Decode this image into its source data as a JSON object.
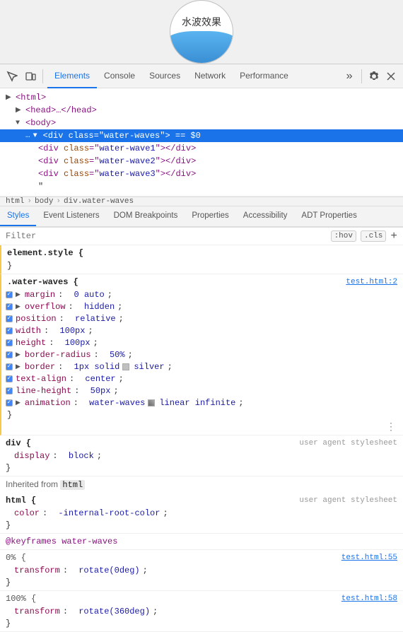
{
  "preview": {
    "label": "水波效果"
  },
  "tabs": {
    "main": [
      {
        "id": "elements",
        "label": "Elements",
        "active": true
      },
      {
        "id": "console",
        "label": "Console"
      },
      {
        "id": "sources",
        "label": "Sources"
      },
      {
        "id": "network",
        "label": "Network"
      },
      {
        "id": "performance",
        "label": "Performance"
      }
    ],
    "sub": [
      {
        "id": "styles",
        "label": "Styles",
        "active": true
      },
      {
        "id": "event-listeners",
        "label": "Event Listeners"
      },
      {
        "id": "dom-breakpoints",
        "label": "DOM Breakpoints"
      },
      {
        "id": "properties",
        "label": "Properties"
      },
      {
        "id": "accessibility",
        "label": "Accessibility"
      },
      {
        "id": "adt-properties",
        "label": "ADT Properties"
      }
    ]
  },
  "dom": {
    "lines": [
      {
        "id": "html",
        "indent": 0,
        "content": "<html>",
        "triangle": "▶",
        "selected": false
      },
      {
        "id": "head",
        "indent": 1,
        "content": "<head>…</head>",
        "triangle": "▶",
        "selected": false
      },
      {
        "id": "body",
        "indent": 1,
        "content": "<body>",
        "triangle": "▼",
        "selected": false
      },
      {
        "id": "div-water-waves",
        "indent": 2,
        "content": "<div class=\"water-waves\"> == $0",
        "triangle": "▼",
        "selected": true
      },
      {
        "id": "div-wave1",
        "indent": 3,
        "content": "<div class=\"water-wave1\"></div>",
        "triangle": "",
        "selected": false
      },
      {
        "id": "div-wave2",
        "indent": 3,
        "content": "<div class=\"water-wave2\"></div>",
        "triangle": "",
        "selected": false
      },
      {
        "id": "div-wave3",
        "indent": 3,
        "content": "<div class=\"water-wave3\"></div>",
        "triangle": "",
        "selected": false
      },
      {
        "id": "quote",
        "indent": 3,
        "content": "\"",
        "triangle": "",
        "selected": false
      }
    ]
  },
  "breadcrumb": {
    "items": [
      "html",
      "body",
      "div.water-waves"
    ]
  },
  "filter": {
    "placeholder": "Filter",
    "hov_label": ":hov",
    "cls_label": ".cls"
  },
  "styles": {
    "sections": [
      {
        "id": "element-style",
        "selector": "element.style {",
        "source": "",
        "props": [],
        "close": "}"
      },
      {
        "id": "water-waves",
        "selector": ".water-waves {",
        "source": "test.html:2",
        "props": [
          {
            "name": "margin",
            "colon": ":",
            "val": "▶ 0 auto",
            "semi": ";",
            "checked": true,
            "triangle": true
          },
          {
            "name": "overflow",
            "colon": ":",
            "val": "▶ hidden",
            "semi": ";",
            "checked": true,
            "triangle": true
          },
          {
            "name": "position",
            "colon": ":",
            "val": "relative",
            "semi": ";",
            "checked": true,
            "triangle": false
          },
          {
            "name": "width",
            "colon": ":",
            "val": "100px",
            "semi": ";",
            "checked": true,
            "triangle": false
          },
          {
            "name": "height",
            "colon": ":",
            "val": "100px",
            "semi": ";",
            "checked": true,
            "triangle": false
          },
          {
            "name": "border-radius",
            "colon": ":",
            "val": "▶ 50%",
            "semi": ";",
            "checked": true,
            "triangle": true
          },
          {
            "name": "border",
            "colon": ":",
            "val": "▶ 1px solid",
            "semi": "",
            "color": "silver",
            "colorname": "silver",
            "checked": true,
            "triangle": true
          },
          {
            "name": "text-align",
            "colon": ":",
            "val": "center",
            "semi": ";",
            "checked": true,
            "triangle": false
          },
          {
            "name": "line-height",
            "colon": ":",
            "val": "50px",
            "semi": ";",
            "checked": true,
            "triangle": false
          },
          {
            "name": "animation",
            "colon": ":",
            "val": "▶ water-waves",
            "semi": "",
            "checked": true,
            "triangle": true,
            "extra": "linear infinite",
            "checkbox2": true
          }
        ],
        "close": "}"
      },
      {
        "id": "div-user-agent",
        "selector": "div {",
        "source": "user agent stylesheet",
        "props": [
          {
            "name": "display",
            "colon": ":",
            "val": "block",
            "semi": ";",
            "checked": false
          }
        ],
        "close": "}"
      }
    ],
    "inherited": {
      "label": "Inherited from",
      "tag": "html",
      "sections": [
        {
          "id": "html-user-agent",
          "selector": "html {",
          "source": "user agent stylesheet",
          "props": [
            {
              "name": "color",
              "colon": ":",
              "val": "-internal-root-color",
              "semi": ";",
              "checked": false
            }
          ],
          "close": "}"
        }
      ]
    },
    "keyframes": [
      {
        "id": "keyframes-water-waves",
        "label": "@keyframes water-waves",
        "stops": [
          {
            "pct": "0%",
            "source": "test.html:55",
            "props": [
              {
                "name": "transform",
                "colon": ":",
                "val": "rotate(0deg)",
                "semi": ";"
              }
            ],
            "close": "}"
          },
          {
            "pct": "100%",
            "source": "test.html:58",
            "props": [
              {
                "name": "transform",
                "colon": ":",
                "val": "rotate(360deg)",
                "semi": ";"
              }
            ],
            "close": "}"
          }
        ]
      }
    ]
  }
}
